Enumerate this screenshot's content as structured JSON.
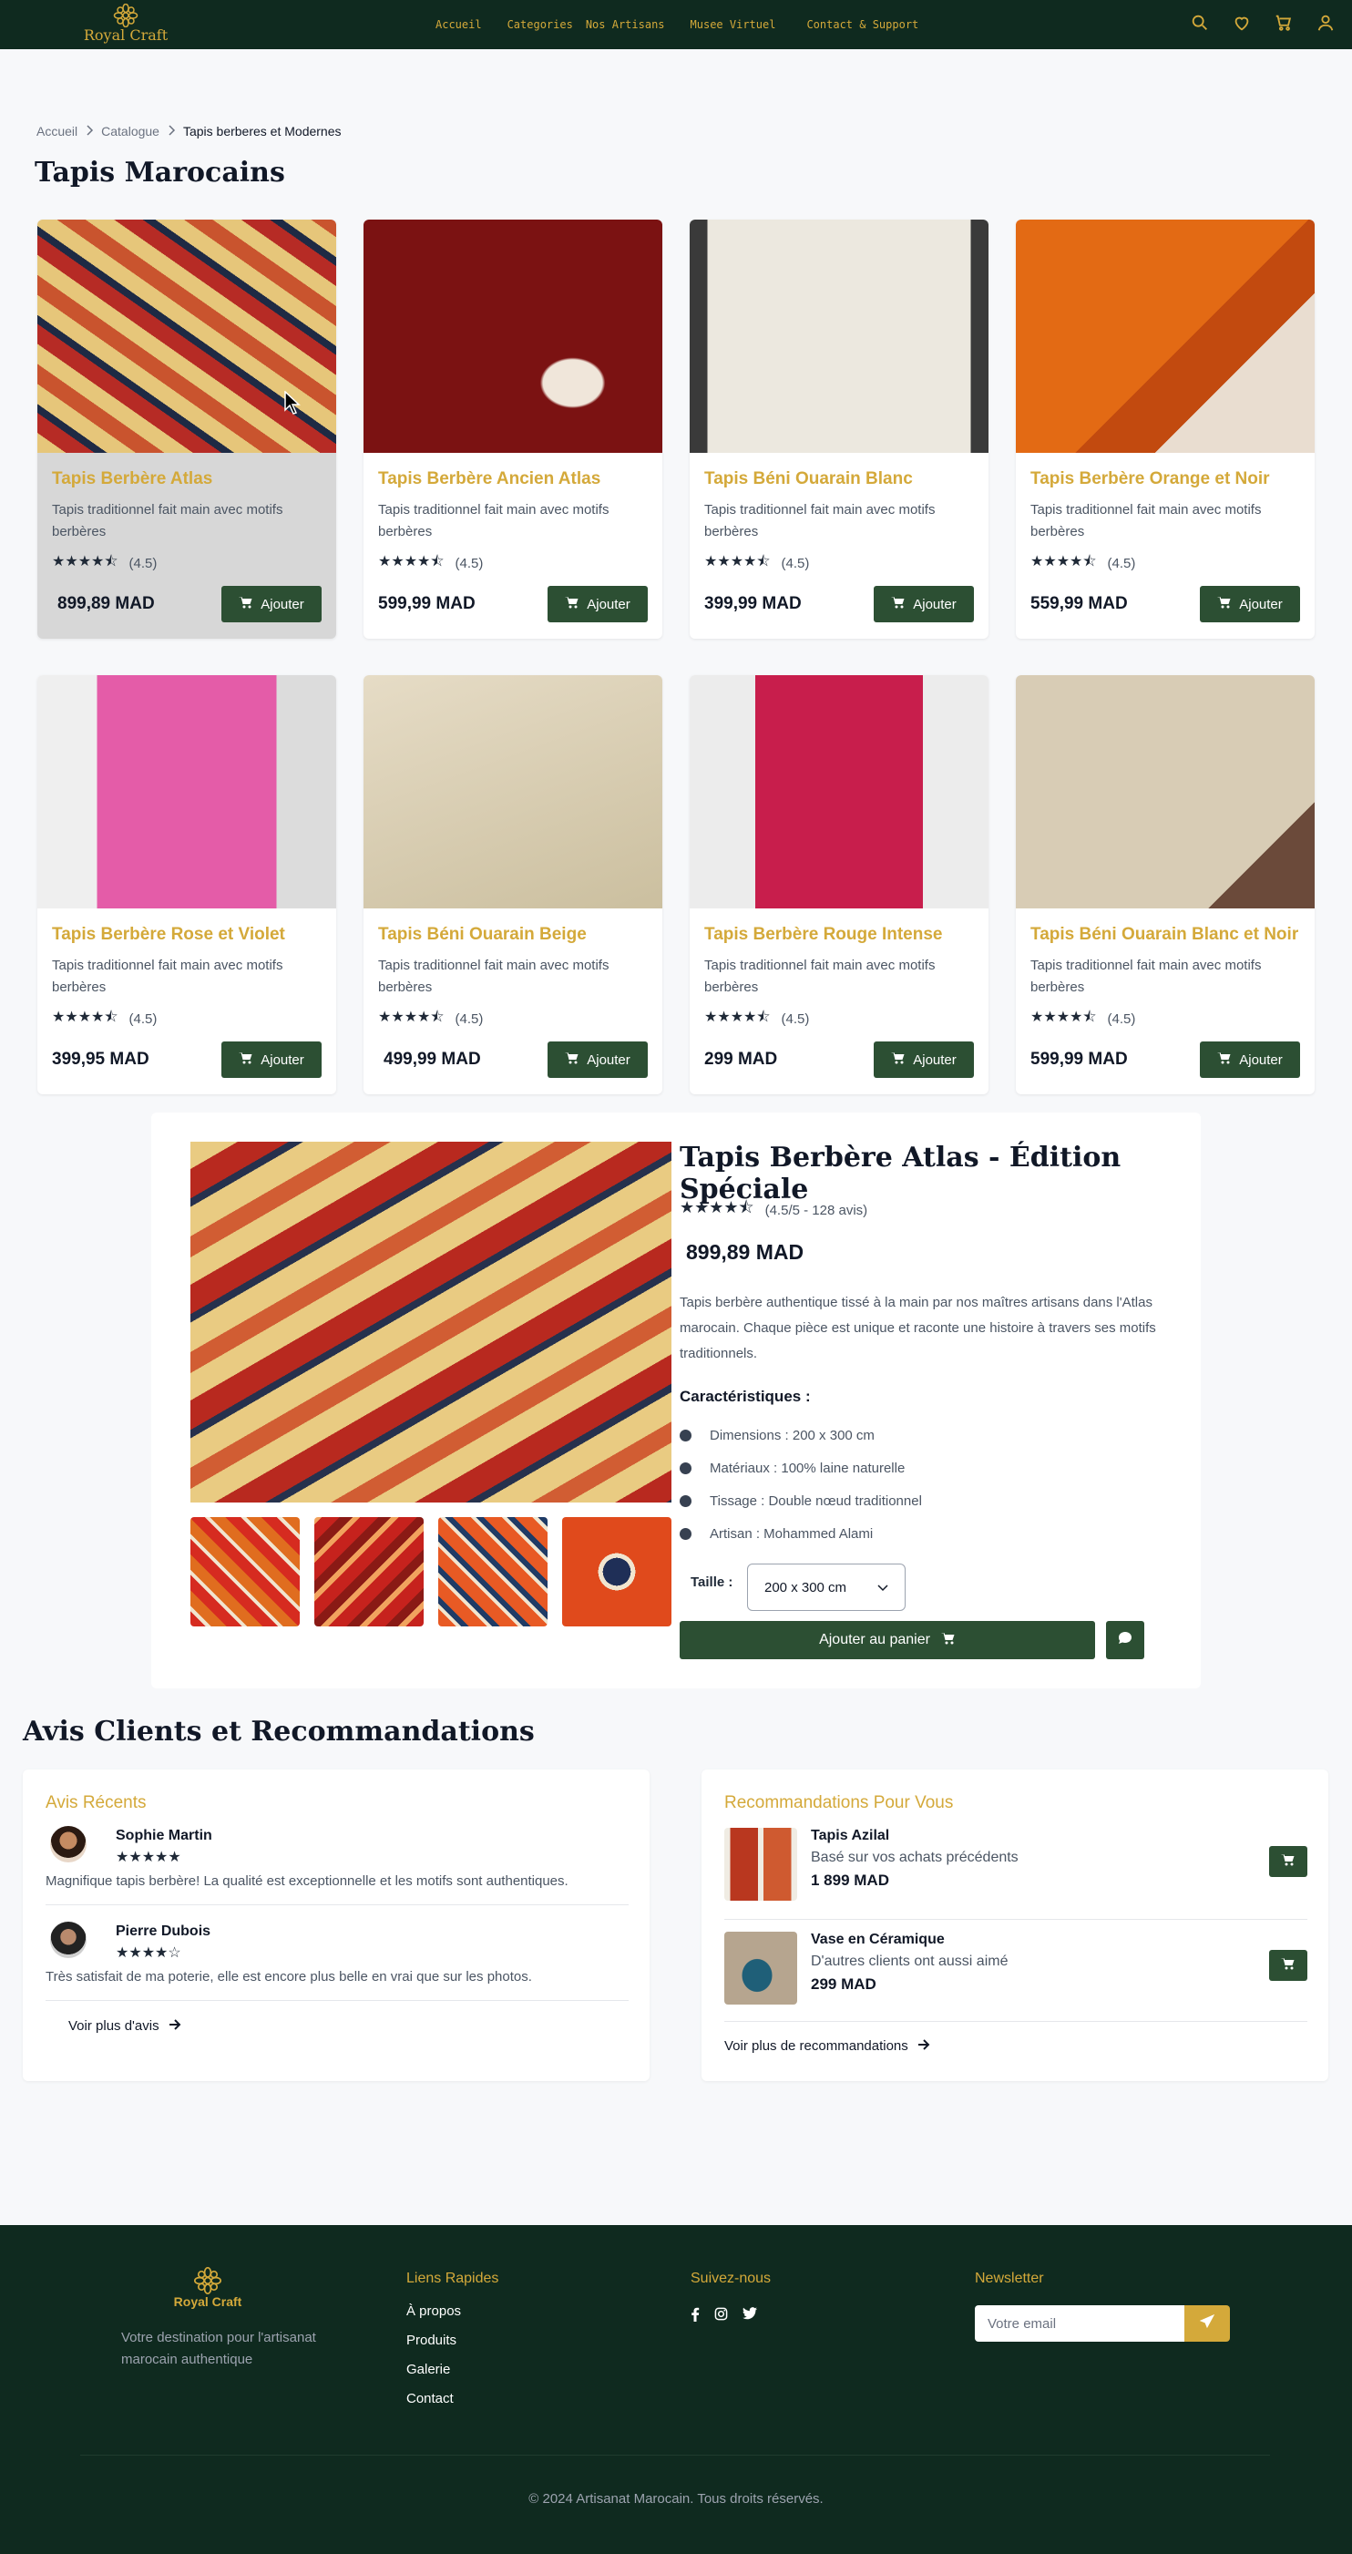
{
  "brand": {
    "name": "Royal Craft",
    "color": "#d4a93a"
  },
  "nav": {
    "links": [
      "Accueil",
      "Categories",
      "Nos Artisans",
      "Musee Virtuel",
      "Contact & Support"
    ],
    "icons": [
      "search-icon",
      "heart-icon",
      "cart-icon",
      "user-icon"
    ]
  },
  "breadcrumb": [
    "Accueil",
    "Catalogue",
    "Tapis berberes et Modernes"
  ],
  "page_title": "Tapis Marocains",
  "products": [
    {
      "name": "Tapis Berbère Atlas",
      "desc": "Tapis traditionnel fait main avec motifs berbères",
      "rating": "(4.5)",
      "price": "899,89 MAD",
      "button": "Ajouter"
    },
    {
      "name": "Tapis Berbère Ancien Atlas",
      "desc": "Tapis traditionnel fait main avec motifs berbères",
      "rating": "(4.5)",
      "price": "599,99 MAD",
      "button": "Ajouter"
    },
    {
      "name": "Tapis Béni Ouarain Blanc",
      "desc": "Tapis traditionnel fait main avec motifs berbères",
      "rating": "(4.5)",
      "price": "399,99 MAD",
      "button": "Ajouter"
    },
    {
      "name": "Tapis Berbère Orange et Noir",
      "desc": "Tapis traditionnel fait main avec motifs berbères",
      "rating": "(4.5)",
      "price": "559,99 MAD",
      "button": "Ajouter"
    },
    {
      "name": "Tapis Berbère Rose et Violet",
      "desc": "Tapis traditionnel fait main avec motifs berbères",
      "rating": "(4.5)",
      "price": "399,95 MAD",
      "button": "Ajouter"
    },
    {
      "name": "Tapis Béni Ouarain Beige",
      "desc": "Tapis traditionnel fait main avec motifs berbères",
      "rating": "(4.5)",
      "price": "499,99 MAD",
      "button": "Ajouter"
    },
    {
      "name": "Tapis Berbère Rouge Intense",
      "desc": "Tapis traditionnel fait main avec motifs berbères",
      "rating": "(4.5)",
      "price": "299 MAD",
      "button": "Ajouter"
    },
    {
      "name": "Tapis Béni Ouarain Blanc et Noir",
      "desc": "Tapis traditionnel fait main avec motifs berbères",
      "rating": "(4.5)",
      "price": "599,99 MAD",
      "button": "Ajouter"
    }
  ],
  "detail": {
    "title": "Tapis Berbère Atlas - Édition Spéciale",
    "rating": "(4.5/5 - 128 avis)",
    "price": "899,89 MAD",
    "description": "Tapis berbère authentique tissé à la main par nos maîtres artisans dans l'Atlas marocain. Chaque pièce est unique et raconte une histoire à travers ses motifs traditionnels.",
    "features_title": "Caractéristiques :",
    "features": [
      "Dimensions : 200 x 300 cm",
      "Matériaux : 100% laine naturelle",
      "Tissage : Double nœud traditionnel",
      "Artisan : Mohammed Alami"
    ],
    "size_label": "Taille :",
    "size_value": "200 x 300 cm",
    "cart_button": "Ajouter au panier"
  },
  "reviews": {
    "section_title": "Avis Clients et Recommandations",
    "title": "Avis Récents",
    "items": [
      {
        "name": "Sophie Martin",
        "stars": "★★★★★",
        "text": "Magnifique tapis berbère! La qualité est exceptionnelle et les motifs sont authentiques."
      },
      {
        "name": "Pierre Dubois",
        "stars": "★★★★☆",
        "text": "Très satisfait de ma poterie, elle est encore plus belle en vrai que sur les photos."
      }
    ],
    "more": "Voir plus d'avis"
  },
  "recommendations": {
    "title": "Recommandations Pour Vous",
    "items": [
      {
        "title": "Tapis Azilal",
        "subtitle": "Basé sur vos achats précédents",
        "price": "1 899 MAD"
      },
      {
        "title": "Vase en Céramique",
        "subtitle": "D'autres clients ont aussi aimé",
        "price": "299 MAD"
      }
    ],
    "more": "Voir plus de recommandations"
  },
  "footer": {
    "brand": "Royal Craft",
    "tagline": "Votre destination pour l'artisanat marocain authentique",
    "quick_title": "Liens Rapides",
    "quick_links": [
      "À propos",
      "Produits",
      "Galerie",
      "Contact"
    ],
    "follow_title": "Suivez-nous",
    "newsletter_title": "Newsletter",
    "newsletter_placeholder": "Votre email",
    "copyright": "© 2024 Artisanat Marocain. Tous droits réservés."
  },
  "colors": {
    "nav_bg": "#0f2a1f",
    "accent": "#d4a93a",
    "button": "#2c4f33"
  }
}
